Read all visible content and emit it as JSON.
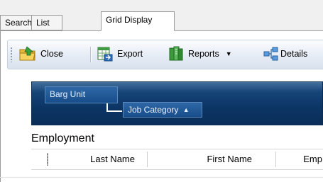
{
  "tabs": [
    {
      "label": "Search"
    },
    {
      "label": "List"
    },
    {
      "label": "Grid Display",
      "active": true
    }
  ],
  "toolbar": {
    "close_label": "Close",
    "export_label": "Export",
    "reports_label": "Reports",
    "details_label": "Details"
  },
  "group_by": {
    "level1": "Barg Unit",
    "level2": "Job Category",
    "level2_sort": "ascending"
  },
  "grid": {
    "band_title": "Employment",
    "columns": [
      "Last Name",
      "First Name",
      "Emp"
    ]
  },
  "colors": {
    "group_panel": "#0c3564",
    "chip": "#1f5a99",
    "toolbar": "#e6ecf5"
  }
}
